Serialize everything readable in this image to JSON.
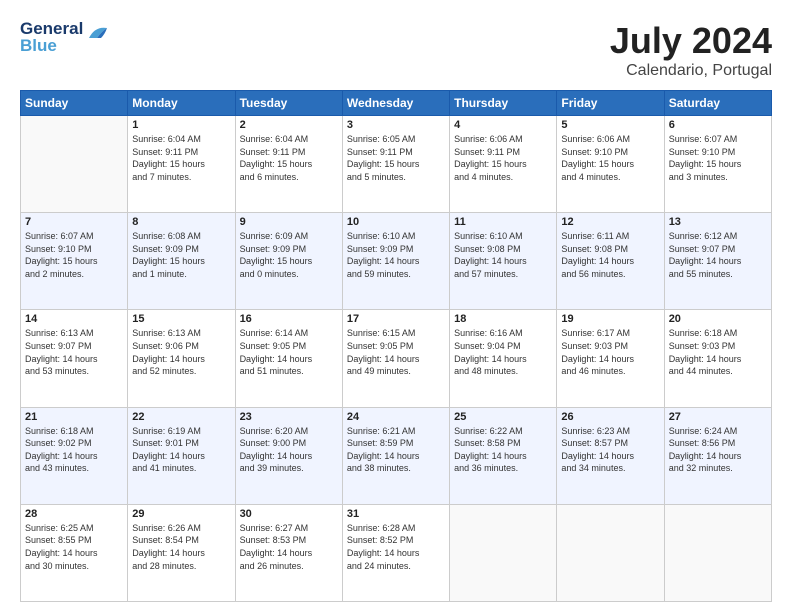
{
  "header": {
    "logo_line1": "General",
    "logo_line2": "Blue",
    "month_year": "July 2024",
    "subtitle": "Calendario, Portugal"
  },
  "weekdays": [
    "Sunday",
    "Monday",
    "Tuesday",
    "Wednesday",
    "Thursday",
    "Friday",
    "Saturday"
  ],
  "weeks": [
    [
      {
        "day": "",
        "info": ""
      },
      {
        "day": "1",
        "info": "Sunrise: 6:04 AM\nSunset: 9:11 PM\nDaylight: 15 hours\nand 7 minutes."
      },
      {
        "day": "2",
        "info": "Sunrise: 6:04 AM\nSunset: 9:11 PM\nDaylight: 15 hours\nand 6 minutes."
      },
      {
        "day": "3",
        "info": "Sunrise: 6:05 AM\nSunset: 9:11 PM\nDaylight: 15 hours\nand 5 minutes."
      },
      {
        "day": "4",
        "info": "Sunrise: 6:06 AM\nSunset: 9:11 PM\nDaylight: 15 hours\nand 4 minutes."
      },
      {
        "day": "5",
        "info": "Sunrise: 6:06 AM\nSunset: 9:10 PM\nDaylight: 15 hours\nand 4 minutes."
      },
      {
        "day": "6",
        "info": "Sunrise: 6:07 AM\nSunset: 9:10 PM\nDaylight: 15 hours\nand 3 minutes."
      }
    ],
    [
      {
        "day": "7",
        "info": "Sunrise: 6:07 AM\nSunset: 9:10 PM\nDaylight: 15 hours\nand 2 minutes."
      },
      {
        "day": "8",
        "info": "Sunrise: 6:08 AM\nSunset: 9:09 PM\nDaylight: 15 hours\nand 1 minute."
      },
      {
        "day": "9",
        "info": "Sunrise: 6:09 AM\nSunset: 9:09 PM\nDaylight: 15 hours\nand 0 minutes."
      },
      {
        "day": "10",
        "info": "Sunrise: 6:10 AM\nSunset: 9:09 PM\nDaylight: 14 hours\nand 59 minutes."
      },
      {
        "day": "11",
        "info": "Sunrise: 6:10 AM\nSunset: 9:08 PM\nDaylight: 14 hours\nand 57 minutes."
      },
      {
        "day": "12",
        "info": "Sunrise: 6:11 AM\nSunset: 9:08 PM\nDaylight: 14 hours\nand 56 minutes."
      },
      {
        "day": "13",
        "info": "Sunrise: 6:12 AM\nSunset: 9:07 PM\nDaylight: 14 hours\nand 55 minutes."
      }
    ],
    [
      {
        "day": "14",
        "info": "Sunrise: 6:13 AM\nSunset: 9:07 PM\nDaylight: 14 hours\nand 53 minutes."
      },
      {
        "day": "15",
        "info": "Sunrise: 6:13 AM\nSunset: 9:06 PM\nDaylight: 14 hours\nand 52 minutes."
      },
      {
        "day": "16",
        "info": "Sunrise: 6:14 AM\nSunset: 9:05 PM\nDaylight: 14 hours\nand 51 minutes."
      },
      {
        "day": "17",
        "info": "Sunrise: 6:15 AM\nSunset: 9:05 PM\nDaylight: 14 hours\nand 49 minutes."
      },
      {
        "day": "18",
        "info": "Sunrise: 6:16 AM\nSunset: 9:04 PM\nDaylight: 14 hours\nand 48 minutes."
      },
      {
        "day": "19",
        "info": "Sunrise: 6:17 AM\nSunset: 9:03 PM\nDaylight: 14 hours\nand 46 minutes."
      },
      {
        "day": "20",
        "info": "Sunrise: 6:18 AM\nSunset: 9:03 PM\nDaylight: 14 hours\nand 44 minutes."
      }
    ],
    [
      {
        "day": "21",
        "info": "Sunrise: 6:18 AM\nSunset: 9:02 PM\nDaylight: 14 hours\nand 43 minutes."
      },
      {
        "day": "22",
        "info": "Sunrise: 6:19 AM\nSunset: 9:01 PM\nDaylight: 14 hours\nand 41 minutes."
      },
      {
        "day": "23",
        "info": "Sunrise: 6:20 AM\nSunset: 9:00 PM\nDaylight: 14 hours\nand 39 minutes."
      },
      {
        "day": "24",
        "info": "Sunrise: 6:21 AM\nSunset: 8:59 PM\nDaylight: 14 hours\nand 38 minutes."
      },
      {
        "day": "25",
        "info": "Sunrise: 6:22 AM\nSunset: 8:58 PM\nDaylight: 14 hours\nand 36 minutes."
      },
      {
        "day": "26",
        "info": "Sunrise: 6:23 AM\nSunset: 8:57 PM\nDaylight: 14 hours\nand 34 minutes."
      },
      {
        "day": "27",
        "info": "Sunrise: 6:24 AM\nSunset: 8:56 PM\nDaylight: 14 hours\nand 32 minutes."
      }
    ],
    [
      {
        "day": "28",
        "info": "Sunrise: 6:25 AM\nSunset: 8:55 PM\nDaylight: 14 hours\nand 30 minutes."
      },
      {
        "day": "29",
        "info": "Sunrise: 6:26 AM\nSunset: 8:54 PM\nDaylight: 14 hours\nand 28 minutes."
      },
      {
        "day": "30",
        "info": "Sunrise: 6:27 AM\nSunset: 8:53 PM\nDaylight: 14 hours\nand 26 minutes."
      },
      {
        "day": "31",
        "info": "Sunrise: 6:28 AM\nSunset: 8:52 PM\nDaylight: 14 hours\nand 24 minutes."
      },
      {
        "day": "",
        "info": ""
      },
      {
        "day": "",
        "info": ""
      },
      {
        "day": "",
        "info": ""
      }
    ]
  ]
}
